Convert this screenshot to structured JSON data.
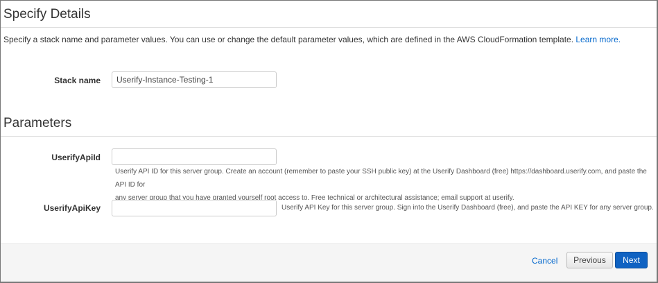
{
  "details": {
    "title": "Specify Details",
    "description": "Specify a stack name and parameter values. You can use or change the default parameter values, which are defined in the AWS CloudFormation template. ",
    "learn_more": "Learn more.",
    "stack_name_label": "Stack name",
    "stack_name_value": "Userify-Instance-Testing-1"
  },
  "parameters": {
    "title": "Parameters",
    "api_id": {
      "label": "UserifyApiId",
      "value": "",
      "help_line1": "Userify API ID for this server group. Create an account (remember to paste your SSH public key) at the Userify Dashboard (free) https://dashboard.userify.com, and paste the API ID for",
      "help_line2": "any server group that you have granted yourself root access to. Free technical or architectural assistance; email support at userify."
    },
    "api_key": {
      "label": "UserifyApiKey",
      "value": "",
      "help": "Userify API Key for this server group. Sign into the Userify Dashboard (free), and paste the API KEY for any server group."
    }
  },
  "footer": {
    "cancel": "Cancel",
    "previous": "Previous",
    "next": "Next"
  }
}
